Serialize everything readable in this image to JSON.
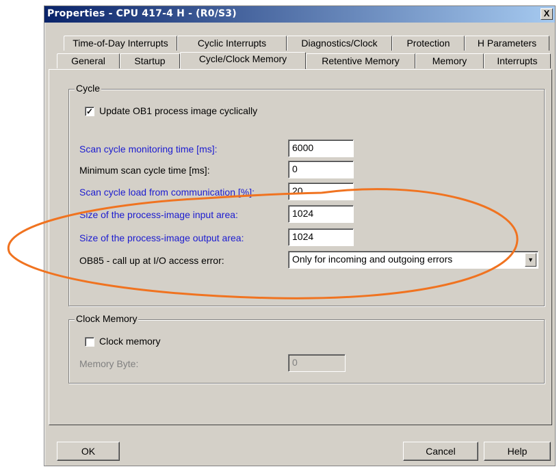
{
  "window": {
    "title": "Properties - CPU 417-4 H - (R0/S3)",
    "close_label": "X"
  },
  "tabs_row1": [
    "Time-of-Day Interrupts",
    "Cyclic Interrupts",
    "Diagnostics/Clock",
    "Protection",
    "H Parameters"
  ],
  "tabs_row2": [
    "General",
    "Startup",
    "Cycle/Clock Memory",
    "Retentive Memory",
    "Memory",
    "Interrupts"
  ],
  "active_tab": "Cycle/Clock Memory",
  "cycle": {
    "group_label": "Cycle",
    "update_ob1_label": "Update OB1 process image cyclically",
    "update_ob1_checked": true,
    "scan_monitor_label": "Scan cycle monitoring time [ms]:",
    "scan_monitor_value": "6000",
    "min_scan_label": "Minimum scan cycle time [ms]:",
    "min_scan_value": "0",
    "scan_load_label": "Scan cycle load from communication [%]:",
    "scan_load_value": "20",
    "input_area_label": "Size of the process-image input area:",
    "input_area_value": "1024",
    "output_area_label": "Size of the process-image output area:",
    "output_area_value": "1024",
    "ob85_label": "OB85 - call up at I/O access error:",
    "ob85_value": "Only for incoming and outgoing errors"
  },
  "clock_memory": {
    "group_label": "Clock Memory",
    "clock_memory_label": "Clock memory",
    "clock_memory_checked": false,
    "memory_byte_label": "Memory Byte:",
    "memory_byte_value": "0"
  },
  "buttons": {
    "ok": "OK",
    "cancel": "Cancel",
    "help": "Help"
  },
  "colors": {
    "annotation": "#f07320",
    "link_label": "#1b1bd0",
    "title_bar": "#0a246a"
  },
  "icons": {
    "dropdown": "chevron-down-icon",
    "checkmark": "checkmark-icon"
  }
}
